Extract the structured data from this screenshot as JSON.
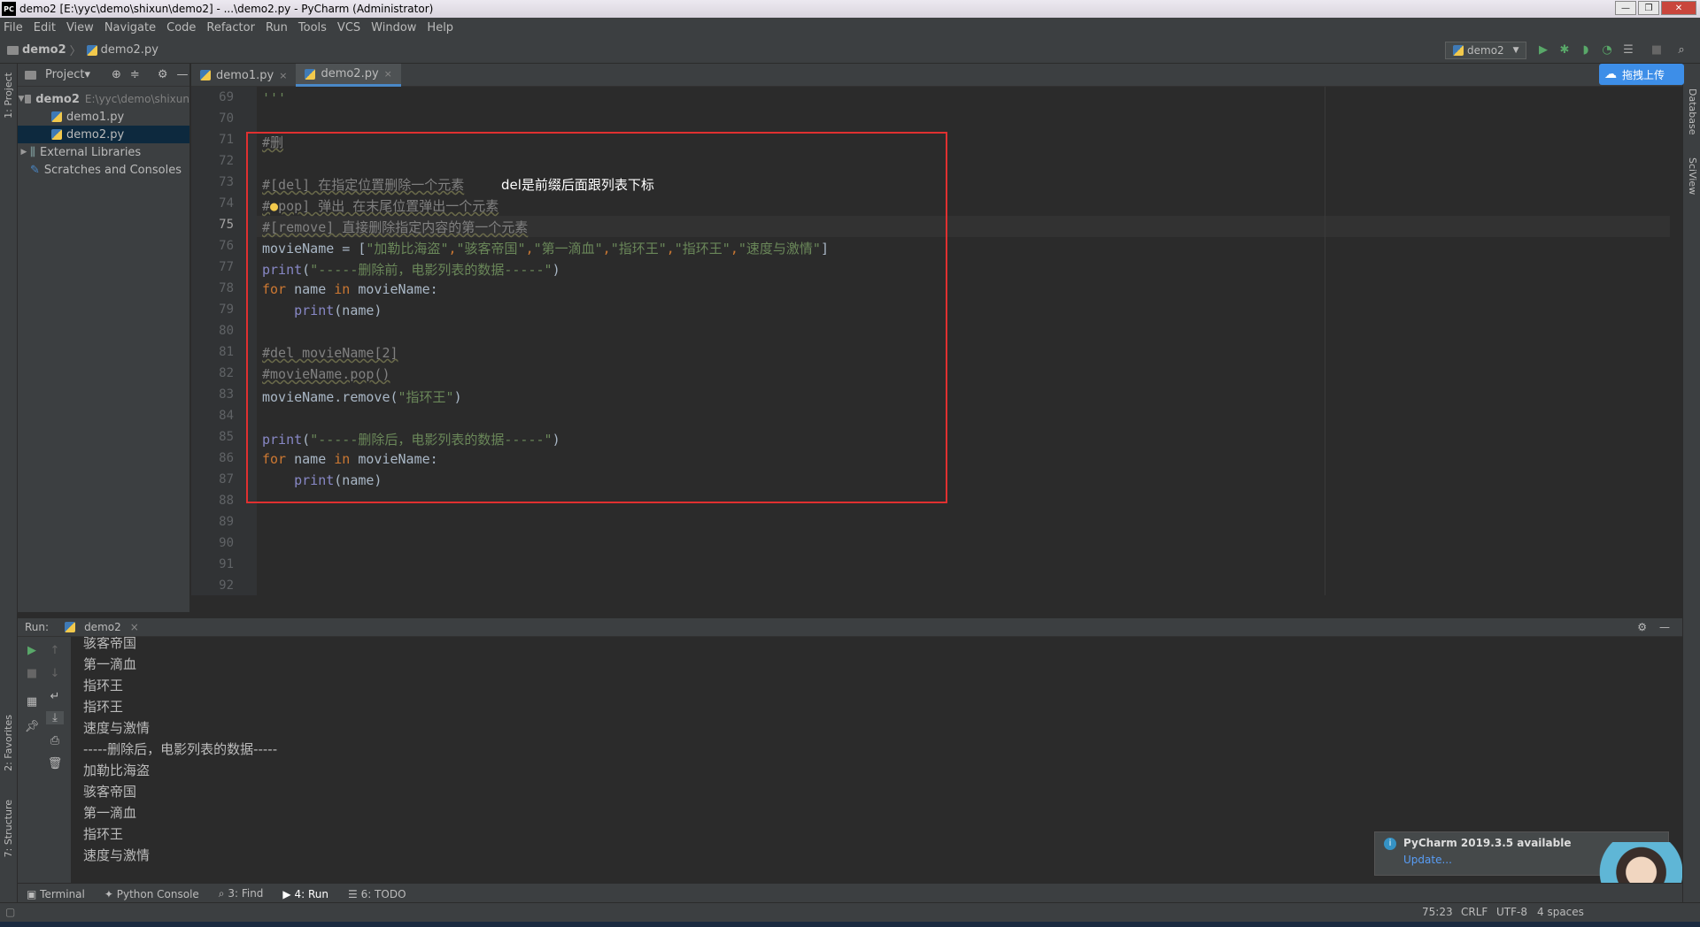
{
  "window": {
    "title": "demo2 [E:\\yyc\\demo\\shixun\\demo2] - ...\\demo2.py - PyCharm (Administrator)",
    "app_badge": "PC"
  },
  "menu": [
    "File",
    "Edit",
    "View",
    "Navigate",
    "Code",
    "Refactor",
    "Run",
    "Tools",
    "VCS",
    "Window",
    "Help"
  ],
  "breadcrumb": {
    "project": "demo2",
    "file": "demo2.py"
  },
  "run_config": "demo2",
  "upload_button": "拖拽上传",
  "project_panel": {
    "title": "Project▾",
    "tree": [
      {
        "label": "demo2",
        "hint": "E:\\yyc\\demo\\shixun"
      },
      {
        "label": "demo1.py"
      },
      {
        "label": "demo2.py"
      },
      {
        "label": "External Libraries"
      },
      {
        "label": "Scratches and Consoles"
      }
    ]
  },
  "left_tabs": {
    "project": "1: Project",
    "favorites": "2: Favorites",
    "structure": "7: Structure"
  },
  "right_tabs": {
    "database": "Database",
    "sciview": "SciView"
  },
  "tabs": [
    {
      "label": "demo1.py",
      "close": "×"
    },
    {
      "label": "demo2.py",
      "close": "×"
    }
  ],
  "editor": {
    "line_numbers": [
      "69",
      "70",
      "71",
      "72",
      "73",
      "74",
      "75",
      "76",
      "77",
      "78",
      "79",
      "80",
      "81",
      "82",
      "83",
      "84",
      "85",
      "86",
      "87",
      "88",
      "89",
      "90",
      "91",
      "92"
    ],
    "current_line": "75",
    "code": {
      "l69": "'''",
      "l71": "#删",
      "l73": "#[del] 在指定位置删除一个元素",
      "l74a": "#",
      "l74b": "pop] 弹出 在末尾位置弹出一个元素",
      "l75": "#[remove] 直接删除指定内容的第一个元素",
      "l76a": "movieName = [",
      "l76b": "\"加勒比海盗\"",
      "l76c": ",",
      "l76d": "\"骇客帝国\"",
      "l76e": ",",
      "l76f": "\"第一滴血\"",
      "l76g": ",",
      "l76h": "\"指环王\"",
      "l76i": ",",
      "l76j": "\"指环王\"",
      "l76k": ",",
      "l76l": "\"速度与激情\"",
      "l76m": "]",
      "l77a": "print",
      "l77b": "(",
      "l77c": "\"-----删除前，电影列表的数据-----\"",
      "l77d": ")",
      "for_kw": "for",
      "name_var": " name ",
      "in_kw": "in",
      "movie_tail": " movieName:",
      "indent_print": "    ",
      "print_fn": "print",
      "print_arg": "(name)",
      "l81": "#del movieName[2]",
      "l82": "#movieName.pop()",
      "l83a": "movieName.remove(",
      "l83b": "\"指环王\"",
      "l83c": ")",
      "l85c": "\"-----删除后，电影列表的数据-----\""
    },
    "annotation": "del是前缀后面跟列表下标"
  },
  "run_panel": {
    "label": "Run:",
    "tab": "demo2",
    "tab_close": "×",
    "output": [
      "骇客帝国",
      "第一滴血",
      "指环王",
      "指环王",
      "速度与激情",
      "-----删除后，电影列表的数据-----",
      "加勒比海盗",
      "骇客帝国",
      "第一滴血",
      "指环王",
      "速度与激情"
    ]
  },
  "notification": {
    "title": "PyCharm 2019.3.5 available",
    "link": "Update..."
  },
  "bottom_tabs": [
    "Terminal",
    "Python Console",
    "3: Find",
    "4: Run",
    "6: TODO"
  ],
  "status": {
    "position": "75:23",
    "line_sep": "CRLF",
    "encoding": "UTF-8",
    "indent": "4 spaces"
  },
  "colors": {
    "keyword": "#cc7832",
    "string": "#6a8759",
    "comment": "#808080",
    "builtin": "#8888c6",
    "highlight_box": "#e03030"
  }
}
